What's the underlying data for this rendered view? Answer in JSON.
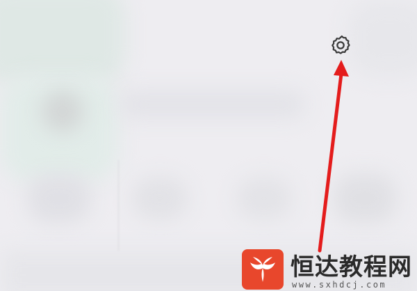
{
  "header": {
    "settings_icon": "gear-icon"
  },
  "annotation": {
    "type": "arrow",
    "color": "#e41c1c",
    "points_to": "settings-button"
  },
  "watermark": {
    "title": "恒达教程网",
    "url": "www.sxhdcj.com",
    "logo_color": "#e8472c"
  }
}
